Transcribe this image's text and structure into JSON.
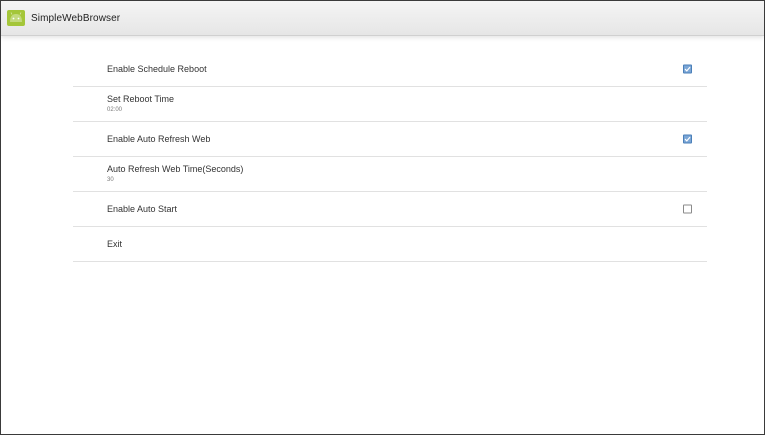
{
  "app": {
    "title": "SimpleWebBrowser",
    "icon": "android-icon",
    "accent_color": "#a4c639"
  },
  "preferences": [
    {
      "title": "Enable Schedule Reboot",
      "type": "checkbox",
      "checked": true
    },
    {
      "title": "Set Reboot Time",
      "summary": "02:00",
      "type": "text"
    },
    {
      "title": "Enable Auto Refresh Web",
      "type": "checkbox",
      "checked": true
    },
    {
      "title": "Auto Refresh Web Time(Seconds)",
      "summary": "30",
      "type": "text"
    },
    {
      "title": "Enable Auto Start",
      "type": "checkbox",
      "checked": false
    },
    {
      "title": "Exit",
      "type": "action"
    }
  ]
}
